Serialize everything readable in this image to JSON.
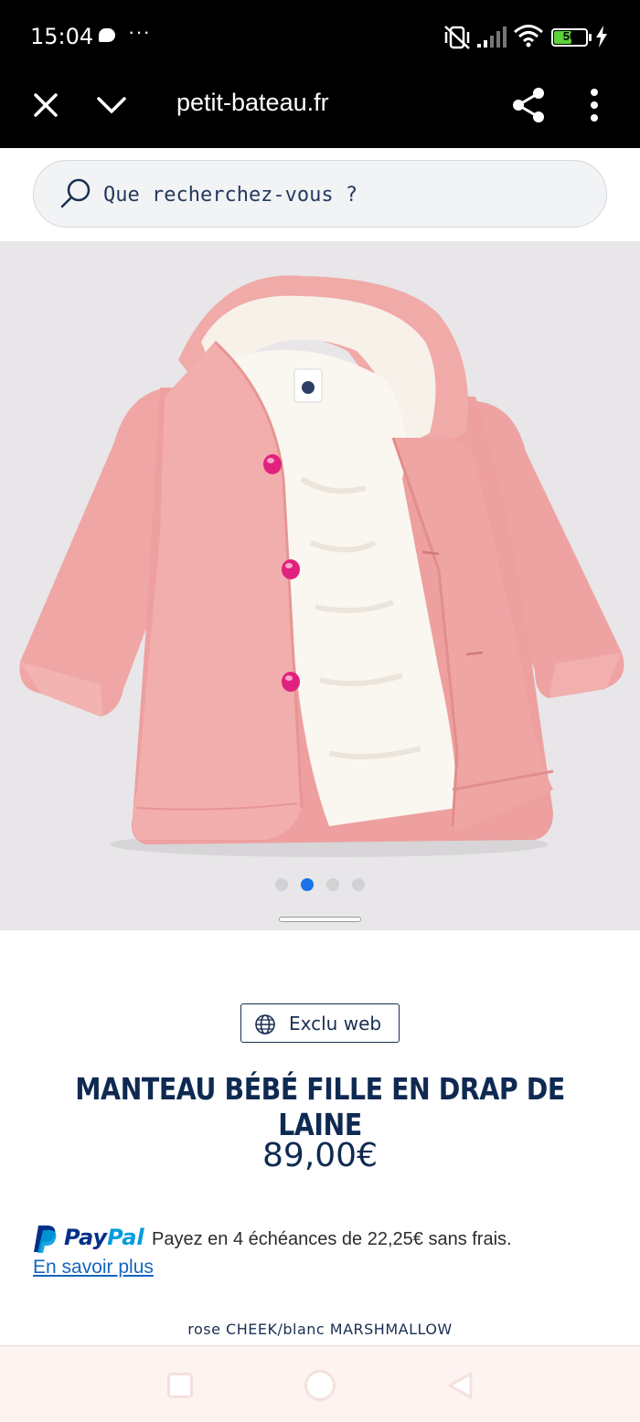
{
  "status_bar": {
    "time": "15:04",
    "more": "···",
    "battery": "50"
  },
  "browser": {
    "url": "petit-bateau.fr"
  },
  "search": {
    "placeholder": "Que recherchez-vous ?"
  },
  "gallery": {
    "image_count": 4,
    "active_index": 1
  },
  "product": {
    "badge": "Exclu web",
    "title": "MANTEAU BÉBÉ FILLE EN DRAP DE LAINE",
    "price": "89,00€",
    "color": "rose CHEEK/blanc MARSHMALLOW"
  },
  "paypal": {
    "brand_pay": "Pay",
    "brand_pal": "Pal",
    "text": "Payez en 4 échéances de 22,25€ sans frais.",
    "link": "En savoir plus"
  },
  "colors": {
    "brand_navy": "#0f2a52",
    "active_dot": "#1a73e8",
    "coat_pink": "#f0a7a6",
    "sherpa": "#faf6f0"
  }
}
